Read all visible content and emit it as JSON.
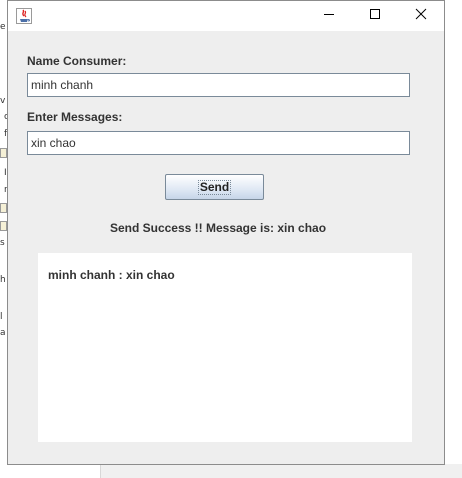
{
  "window": {
    "icon": "java-cup-icon",
    "controls": [
      "minimize-icon",
      "maximize-icon",
      "close-icon"
    ]
  },
  "form": {
    "name_label": "Name Consumer:",
    "name_value": "minh chanh",
    "message_label": "Enter Messages:",
    "message_value": "xin chao",
    "send_label": "Send"
  },
  "status": {
    "text": "Send Success !! Message is: xin chao"
  },
  "messages": [
    {
      "text": "minh chanh : xin chao"
    }
  ],
  "colors": {
    "panel_bg": "#eeeeee",
    "field_border": "#7a8a99",
    "text": "#333333"
  }
}
